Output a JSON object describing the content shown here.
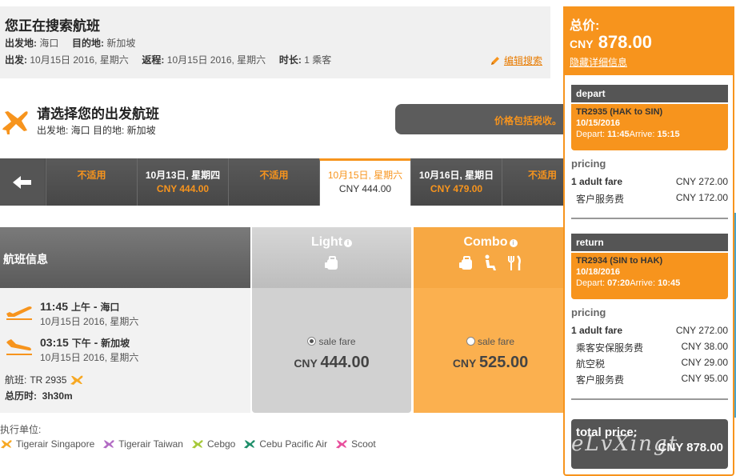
{
  "search": {
    "title": "您正在搜索航班",
    "from_label": "出发地:",
    "from_value": "海口",
    "to_label": "目的地:",
    "to_value": "新加坡",
    "depart_label": "出发:",
    "depart_value": "10月15日 2016, 星期六",
    "return_label": "返程:",
    "return_value": "10月15日 2016, 星期六",
    "duration_label": "时长:",
    "duration_value": "1 乘客",
    "edit_label": "编辑搜索"
  },
  "total": {
    "label": "总价:",
    "currency": "CNY",
    "amount": "878.00",
    "hide_label": "隐藏详细信息"
  },
  "select": {
    "title": "请选择您的出发航班",
    "subtitle": "出发地: 海口 目的地: 新加坡",
    "included": "价格包括税收。"
  },
  "dates": [
    {
      "day": "不适用",
      "price": "",
      "state": "na"
    },
    {
      "day": "10月13日, 星期四",
      "price": "CNY 444.00",
      "state": "normal"
    },
    {
      "day": "不适用",
      "price": "",
      "state": "na"
    },
    {
      "day": "10月15日, 星期六",
      "price": "CNY 444.00",
      "state": "sel"
    },
    {
      "day": "10月16日, 星期日",
      "price": "CNY 479.00",
      "state": "normal"
    },
    {
      "day": "不适用",
      "price": "",
      "state": "na"
    }
  ],
  "fare_table": {
    "info_head": "航班信息",
    "depart_time": "11:45",
    "depart_ampm": "上午",
    "depart_place": "海口",
    "depart_date": "10月15日 2016, 星期六",
    "arrive_time": "03:15",
    "arrive_ampm": "下午",
    "arrive_place": "新加坡",
    "arrive_date": "10月15日 2016, 星期六",
    "flight_label": "航班:",
    "flight_no": "TR 2935",
    "duration_label": "总历时:",
    "duration_value": "3h30m",
    "light": {
      "name": "Light",
      "radio": "sale fare",
      "currency": "CNY",
      "price": "444.00"
    },
    "combo": {
      "name": "Combo",
      "radio": "sale fare",
      "currency": "CNY",
      "price": "525.00"
    }
  },
  "operators": {
    "label": "执行单位:",
    "list": [
      {
        "name": "Tigerair Singapore",
        "color": "#f7a823"
      },
      {
        "name": "Tigerair Taiwan",
        "color": "#b26cc4"
      },
      {
        "name": "Cebgo",
        "color": "#a6c93a"
      },
      {
        "name": "Cebu Pacific Air",
        "color": "#1f8f6a"
      },
      {
        "name": "Scoot",
        "color": "#e84f9c"
      }
    ]
  },
  "panel": {
    "depart": {
      "head": "depart",
      "flight": "TR2935 (HAK to SIN)",
      "date": "10/15/2016",
      "dep_label": "Depart:",
      "dep_time": "11:45",
      "arr_label": "Arrive:",
      "arr_time": "15:15"
    },
    "depart_pricing": {
      "head": "pricing",
      "rows": [
        {
          "k": "1 adult fare",
          "v": "CNY 272.00",
          "main": true
        },
        {
          "k": "客户服务费",
          "v": "CNY 172.00",
          "main": false
        }
      ]
    },
    "return": {
      "head": "return",
      "flight": "TR2934 (SIN to HAK)",
      "date": "10/18/2016",
      "dep_label": "Depart:",
      "dep_time": "07:20",
      "arr_label": "Arrive:",
      "arr_time": "10:45"
    },
    "return_pricing": {
      "head": "pricing",
      "rows": [
        {
          "k": "1 adult fare",
          "v": "CNY 272.00",
          "main": true
        },
        {
          "k": "乘客安保服务费",
          "v": "CNY 38.00",
          "main": false
        },
        {
          "k": "航空税",
          "v": "CNY 29.00",
          "main": false
        },
        {
          "k": "客户服务费",
          "v": "CNY 95.00",
          "main": false
        }
      ]
    },
    "total_label": "total price:",
    "total_value": "CNY 878.00"
  },
  "watermark": "eLvXingt",
  "colors": {
    "accent": "#f7941d",
    "dark": "#555555"
  }
}
